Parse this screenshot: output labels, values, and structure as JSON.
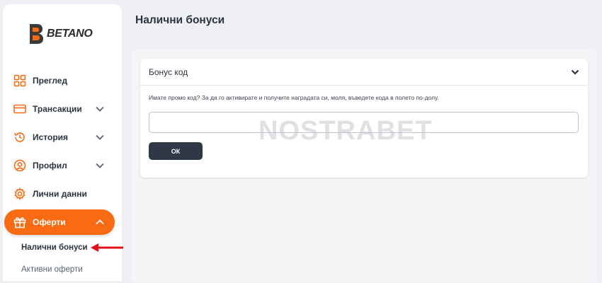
{
  "brand": {
    "name": "BETANO",
    "accent": "#f96b12",
    "dark": "#2f3846"
  },
  "sidebar": {
    "items": [
      {
        "label": "Преглед",
        "icon": "grid-icon"
      },
      {
        "label": "Трансакции",
        "icon": "card-icon",
        "chevron": "chevron-down-icon"
      },
      {
        "label": "История",
        "icon": "history-icon",
        "chevron": "chevron-down-icon"
      },
      {
        "label": "Профил",
        "icon": "user-icon",
        "chevron": "chevron-down-icon"
      },
      {
        "label": "Лични данни",
        "icon": "gear-icon"
      },
      {
        "label": "Оферти",
        "icon": "gift-icon",
        "chevron": "chevron-up-icon",
        "active": true
      }
    ],
    "subitems": [
      {
        "label": "Налични бонуси",
        "current": true
      },
      {
        "label": "Активни оферти"
      }
    ]
  },
  "main": {
    "title": "Налични бонуси",
    "card": {
      "title": "Бонус код",
      "description": "Имате промо код? За да го активирате и получите наградата си, моля, въведете кода в полето по-долу.",
      "input_value": "",
      "button_label": "ОК"
    }
  },
  "watermark": {
    "text": "NOSTRABET"
  }
}
